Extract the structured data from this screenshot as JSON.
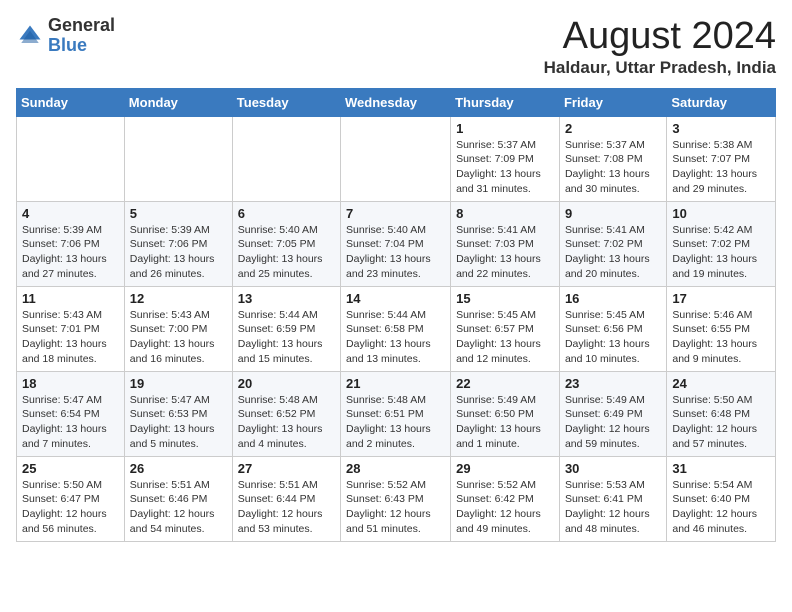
{
  "logo": {
    "general": "General",
    "blue": "Blue"
  },
  "title": "August 2024",
  "subtitle": "Haldaur, Uttar Pradesh, India",
  "days_of_week": [
    "Sunday",
    "Monday",
    "Tuesday",
    "Wednesday",
    "Thursday",
    "Friday",
    "Saturday"
  ],
  "weeks": [
    [
      {
        "day": "",
        "info": ""
      },
      {
        "day": "",
        "info": ""
      },
      {
        "day": "",
        "info": ""
      },
      {
        "day": "",
        "info": ""
      },
      {
        "day": "1",
        "info": "Sunrise: 5:37 AM\nSunset: 7:09 PM\nDaylight: 13 hours\nand 31 minutes."
      },
      {
        "day": "2",
        "info": "Sunrise: 5:37 AM\nSunset: 7:08 PM\nDaylight: 13 hours\nand 30 minutes."
      },
      {
        "day": "3",
        "info": "Sunrise: 5:38 AM\nSunset: 7:07 PM\nDaylight: 13 hours\nand 29 minutes."
      }
    ],
    [
      {
        "day": "4",
        "info": "Sunrise: 5:39 AM\nSunset: 7:06 PM\nDaylight: 13 hours\nand 27 minutes."
      },
      {
        "day": "5",
        "info": "Sunrise: 5:39 AM\nSunset: 7:06 PM\nDaylight: 13 hours\nand 26 minutes."
      },
      {
        "day": "6",
        "info": "Sunrise: 5:40 AM\nSunset: 7:05 PM\nDaylight: 13 hours\nand 25 minutes."
      },
      {
        "day": "7",
        "info": "Sunrise: 5:40 AM\nSunset: 7:04 PM\nDaylight: 13 hours\nand 23 minutes."
      },
      {
        "day": "8",
        "info": "Sunrise: 5:41 AM\nSunset: 7:03 PM\nDaylight: 13 hours\nand 22 minutes."
      },
      {
        "day": "9",
        "info": "Sunrise: 5:41 AM\nSunset: 7:02 PM\nDaylight: 13 hours\nand 20 minutes."
      },
      {
        "day": "10",
        "info": "Sunrise: 5:42 AM\nSunset: 7:02 PM\nDaylight: 13 hours\nand 19 minutes."
      }
    ],
    [
      {
        "day": "11",
        "info": "Sunrise: 5:43 AM\nSunset: 7:01 PM\nDaylight: 13 hours\nand 18 minutes."
      },
      {
        "day": "12",
        "info": "Sunrise: 5:43 AM\nSunset: 7:00 PM\nDaylight: 13 hours\nand 16 minutes."
      },
      {
        "day": "13",
        "info": "Sunrise: 5:44 AM\nSunset: 6:59 PM\nDaylight: 13 hours\nand 15 minutes."
      },
      {
        "day": "14",
        "info": "Sunrise: 5:44 AM\nSunset: 6:58 PM\nDaylight: 13 hours\nand 13 minutes."
      },
      {
        "day": "15",
        "info": "Sunrise: 5:45 AM\nSunset: 6:57 PM\nDaylight: 13 hours\nand 12 minutes."
      },
      {
        "day": "16",
        "info": "Sunrise: 5:45 AM\nSunset: 6:56 PM\nDaylight: 13 hours\nand 10 minutes."
      },
      {
        "day": "17",
        "info": "Sunrise: 5:46 AM\nSunset: 6:55 PM\nDaylight: 13 hours\nand 9 minutes."
      }
    ],
    [
      {
        "day": "18",
        "info": "Sunrise: 5:47 AM\nSunset: 6:54 PM\nDaylight: 13 hours\nand 7 minutes."
      },
      {
        "day": "19",
        "info": "Sunrise: 5:47 AM\nSunset: 6:53 PM\nDaylight: 13 hours\nand 5 minutes."
      },
      {
        "day": "20",
        "info": "Sunrise: 5:48 AM\nSunset: 6:52 PM\nDaylight: 13 hours\nand 4 minutes."
      },
      {
        "day": "21",
        "info": "Sunrise: 5:48 AM\nSunset: 6:51 PM\nDaylight: 13 hours\nand 2 minutes."
      },
      {
        "day": "22",
        "info": "Sunrise: 5:49 AM\nSunset: 6:50 PM\nDaylight: 13 hours\nand 1 minute."
      },
      {
        "day": "23",
        "info": "Sunrise: 5:49 AM\nSunset: 6:49 PM\nDaylight: 12 hours\nand 59 minutes."
      },
      {
        "day": "24",
        "info": "Sunrise: 5:50 AM\nSunset: 6:48 PM\nDaylight: 12 hours\nand 57 minutes."
      }
    ],
    [
      {
        "day": "25",
        "info": "Sunrise: 5:50 AM\nSunset: 6:47 PM\nDaylight: 12 hours\nand 56 minutes."
      },
      {
        "day": "26",
        "info": "Sunrise: 5:51 AM\nSunset: 6:46 PM\nDaylight: 12 hours\nand 54 minutes."
      },
      {
        "day": "27",
        "info": "Sunrise: 5:51 AM\nSunset: 6:44 PM\nDaylight: 12 hours\nand 53 minutes."
      },
      {
        "day": "28",
        "info": "Sunrise: 5:52 AM\nSunset: 6:43 PM\nDaylight: 12 hours\nand 51 minutes."
      },
      {
        "day": "29",
        "info": "Sunrise: 5:52 AM\nSunset: 6:42 PM\nDaylight: 12 hours\nand 49 minutes."
      },
      {
        "day": "30",
        "info": "Sunrise: 5:53 AM\nSunset: 6:41 PM\nDaylight: 12 hours\nand 48 minutes."
      },
      {
        "day": "31",
        "info": "Sunrise: 5:54 AM\nSunset: 6:40 PM\nDaylight: 12 hours\nand 46 minutes."
      }
    ]
  ]
}
